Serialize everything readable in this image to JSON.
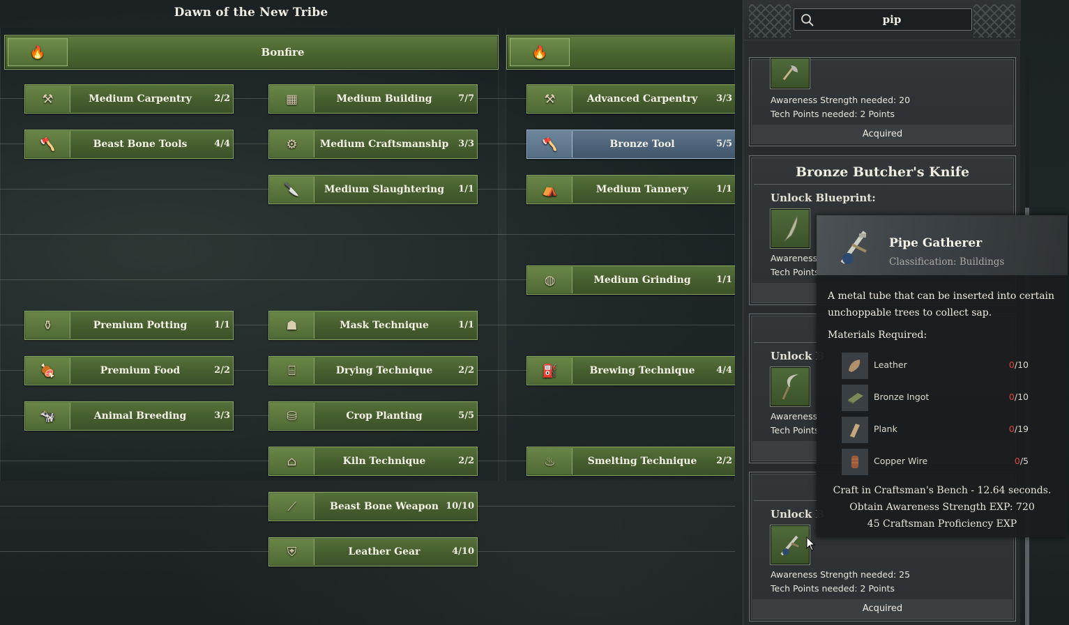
{
  "tree": {
    "title": "Dawn of the New Tribe",
    "headers": [
      {
        "label": "Bonfire",
        "icon": "bonfire-icon"
      },
      {
        "label": "",
        "icon": "forge-icon"
      }
    ],
    "nodes": [
      {
        "label": "Medium Carpentry",
        "count": "2/2",
        "icon": "saw-bench-icon",
        "glyph": "⚒"
      },
      {
        "label": "Beast Bone Tools",
        "count": "4/4",
        "icon": "bone-axe-icon",
        "glyph": "🪓"
      },
      {
        "label": "Premium Potting",
        "count": "1/1",
        "icon": "pot-icon",
        "glyph": "⚱"
      },
      {
        "label": "Premium Food",
        "count": "2/2",
        "icon": "food-icon",
        "glyph": "🍖"
      },
      {
        "label": "Animal Breeding",
        "count": "3/3",
        "icon": "pen-icon",
        "glyph": "🐄"
      },
      {
        "label": "Medium Building",
        "count": "7/7",
        "icon": "crate-icon",
        "glyph": "▦"
      },
      {
        "label": "Medium Craftsmanship",
        "count": "3/3",
        "icon": "workbench-icon",
        "glyph": "⚙"
      },
      {
        "label": "Medium Slaughtering",
        "count": "1/1",
        "icon": "slaughter-icon",
        "glyph": "🔪"
      },
      {
        "label": "Mask Technique",
        "count": "1/1",
        "icon": "mask-icon",
        "glyph": "☗"
      },
      {
        "label": "Drying Technique",
        "count": "2/2",
        "icon": "drying-rack-icon",
        "glyph": "⌸"
      },
      {
        "label": "Crop Planting",
        "count": "5/5",
        "icon": "seed-pot-icon",
        "glyph": "⛁"
      },
      {
        "label": "Kiln Technique",
        "count": "2/2",
        "icon": "kiln-icon",
        "glyph": "⌂"
      },
      {
        "label": "Beast Bone Weapon",
        "count": "10/10",
        "icon": "spear-icon",
        "glyph": "⟋"
      },
      {
        "label": "Leather Gear",
        "count": "4/10",
        "icon": "leather-armor-icon",
        "glyph": "⛨"
      },
      {
        "label": "Advanced Carpentry",
        "count": "3/3",
        "icon": "carpentry-table-icon",
        "glyph": "⚒"
      },
      {
        "label": "Bronze Tool",
        "count": "5/5",
        "icon": "bronze-axe-icon",
        "glyph": "🪓"
      },
      {
        "label": "Medium Tannery",
        "count": "1/1",
        "icon": "tannery-icon",
        "glyph": "⛺"
      },
      {
        "label": "Medium Grinding",
        "count": "1/1",
        "icon": "grindstone-icon",
        "glyph": "◍"
      },
      {
        "label": "Brewing Technique",
        "count": "4/4",
        "icon": "brewing-icon",
        "glyph": "⛽"
      },
      {
        "label": "Smelting Technique",
        "count": "2/2",
        "icon": "furnace-icon",
        "glyph": "♨"
      }
    ]
  },
  "search": {
    "value": "pip",
    "icon": "search-icon"
  },
  "cards": [
    {
      "title": "",
      "unlock_label": "",
      "req_strength": "Awareness Strength needed: 20",
      "req_points": "Tech Points needed: 2 Points",
      "status": "Acquired",
      "icon": "axe-blueprint-icon"
    },
    {
      "title": "Bronze Butcher's Knife",
      "unlock_label": "Unlock Blueprint:",
      "req_strength": "Awareness",
      "req_points": "Tech Points",
      "status": "",
      "icon": "knife-blueprint-icon"
    },
    {
      "title": "",
      "unlock_label": "Unlock B",
      "req_strength": "Awareness",
      "req_points": "Tech Points",
      "status": "",
      "icon": "sickle-blueprint-icon"
    },
    {
      "title": "",
      "unlock_label": "Unlock B",
      "req_strength": "Awareness Strength needed: 25",
      "req_points": "Tech Points needed: 2 Points",
      "status": "Acquired",
      "icon": "pipe-blueprint-icon"
    }
  ],
  "tooltip": {
    "name": "Pipe Gatherer",
    "classification": "Classification: Buildings",
    "description": "A metal tube that can be inserted into certain unchoppable trees to collect sap.",
    "materials_title": "Materials Required:",
    "materials": [
      {
        "name": "Leather",
        "have": "0",
        "need": "/10",
        "icon": "leather-icon"
      },
      {
        "name": "Bronze Ingot",
        "have": "0",
        "need": "/10",
        "icon": "bronze-ingot-icon"
      },
      {
        "name": "Plank",
        "have": "0",
        "need": "/19",
        "icon": "plank-icon"
      },
      {
        "name": "Copper Wire",
        "have": "0",
        "need": "/5",
        "icon": "copper-wire-icon"
      }
    ],
    "craft_line": "Craft in Craftsman's Bench - 12.64 seconds.",
    "exp_line": "Obtain Awareness Strength EXP: 720",
    "prof_line": "45 Craftsman Proficiency EXP"
  },
  "colors": {
    "node_green": "#4a6430",
    "node_selected_blue": "#4c6379",
    "missing_red": "#e0453c"
  }
}
